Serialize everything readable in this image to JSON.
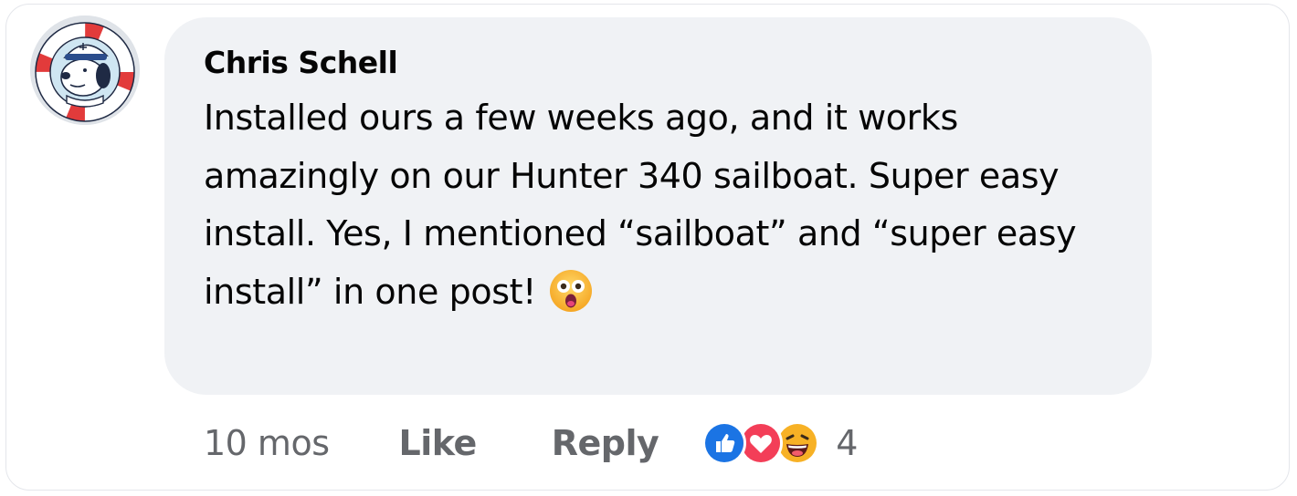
{
  "comment": {
    "author": "Chris Schell",
    "text": "Installed ours a few weeks ago, and it works amazingly on our Hunter 340 sailboat. Super easy install. Yes, I mentioned “sailboat” and “super easy install” in one post!",
    "text_emoji": "astonished-face-emoji",
    "avatar": "snoopy-sailor-life-ring-avatar"
  },
  "actions": {
    "timestamp": "10 mos",
    "like_label": "Like",
    "reply_label": "Reply"
  },
  "reactions": {
    "icons": [
      "like-icon",
      "love-icon",
      "haha-icon"
    ],
    "count": "4"
  },
  "colors": {
    "bubble_bg": "#f0f2f5",
    "text": "#050505",
    "secondary_text": "#65676b",
    "like_blue": "#1b74e4",
    "love_red": "#f33e58",
    "haha_yellow": "#f7b125"
  }
}
